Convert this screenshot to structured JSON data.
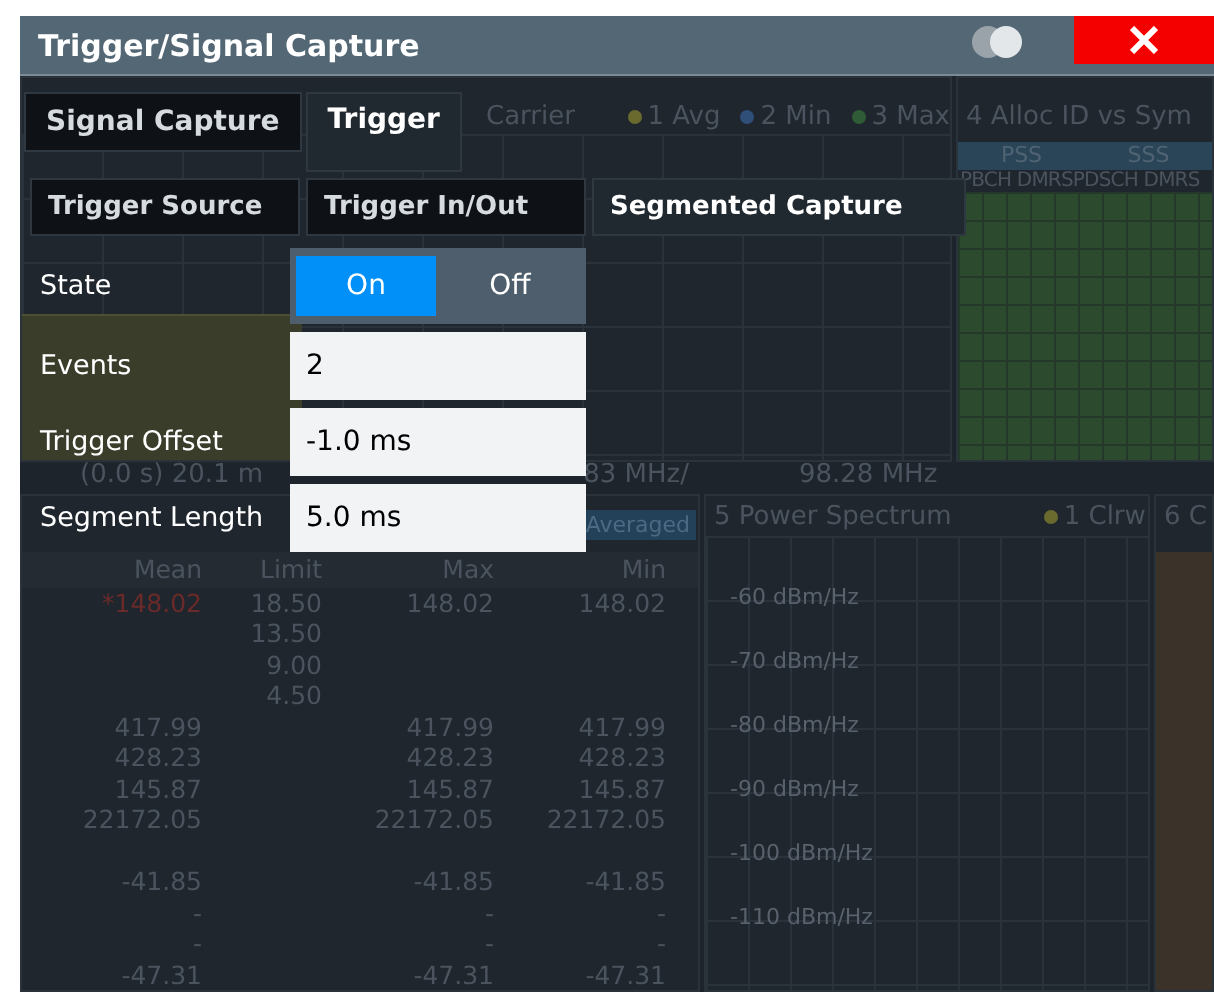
{
  "dialog": {
    "title": "Trigger/Signal Capture"
  },
  "tabs": [
    {
      "label": "Signal Capture",
      "selected": false
    },
    {
      "label": "Trigger",
      "selected": true
    }
  ],
  "subtabs": [
    {
      "label": "Trigger Source",
      "selected": false
    },
    {
      "label": "Trigger In/Out",
      "selected": false
    },
    {
      "label": "Segmented Capture",
      "selected": true
    }
  ],
  "state": {
    "label": "State",
    "options": [
      {
        "label": "On",
        "selected": true
      },
      {
        "label": "Off",
        "selected": false
      }
    ]
  },
  "fields": [
    {
      "label": "Events",
      "value": "2"
    },
    {
      "label": "Trigger Offset",
      "value": "-1.0 ms"
    },
    {
      "label": "Segment Length",
      "value": "5.0 ms"
    }
  ],
  "background": {
    "panel_1": {
      "title": "Carrier",
      "traces": [
        {
          "label": "1 Avg",
          "color": "#6b6a2e"
        },
        {
          "label": "2 Min",
          "color": "#2f4e78"
        },
        {
          "label": "3 Max",
          "color": "#2f5c36"
        }
      ]
    },
    "panel_4": {
      "title": "4 Alloc ID vs Sym",
      "bands": [
        "PSS",
        "SSS"
      ],
      "channels": "PBCH DMRSPDSCH DMRS"
    },
    "freq_axis": {
      "start": "(0.0 s)  20.1 m",
      "span": "83 MHz/",
      "stop": "98.28 MHz"
    },
    "result_table": {
      "badge": "Averaged",
      "columns": [
        "Mean",
        "Limit",
        "Max",
        "Min"
      ],
      "rows": [
        {
          "mean": "*148.02",
          "limit": "18.50",
          "max": "148.02",
          "min": "148.02",
          "color": "#6a2a2a"
        },
        {
          "limit": "13.50"
        },
        {
          "limit": "9.00"
        },
        {
          "limit": "4.50"
        },
        {
          "mean": "417.99",
          "max": "417.99",
          "min": "417.99",
          "color": "#4b545e"
        },
        {
          "mean": "428.23",
          "max": "428.23",
          "min": "428.23",
          "color": "#4b545e"
        },
        {
          "mean": "145.87",
          "max": "145.87",
          "min": "145.87",
          "color": "#4b545e"
        },
        {
          "mean": "22172.05",
          "max": "22172.05",
          "min": "22172.05",
          "color": "#4b545e"
        },
        {},
        {
          "mean": "-41.85",
          "max": "-41.85",
          "min": "-41.85",
          "color": "#4b545e"
        },
        {
          "mean": "-",
          "max": "-",
          "min": "-",
          "color": "#4b545e"
        },
        {
          "mean": "-",
          "max": "-",
          "min": "-",
          "color": "#4b545e"
        },
        {
          "mean": "-47.31",
          "max": "-47.31",
          "min": "-47.31",
          "color": "#4b545e"
        }
      ]
    },
    "panel_5": {
      "title": "5 Power Spectrum",
      "trace": {
        "label": "1 Clrw",
        "color": "#6b6a2e"
      },
      "y_labels": [
        "-60 dBm/Hz",
        "-70 dBm/Hz",
        "-80 dBm/Hz",
        "-90 dBm/Hz",
        "-100 dBm/Hz",
        "-110 dBm/Hz"
      ]
    },
    "panel_6": {
      "title": "6 C"
    }
  }
}
